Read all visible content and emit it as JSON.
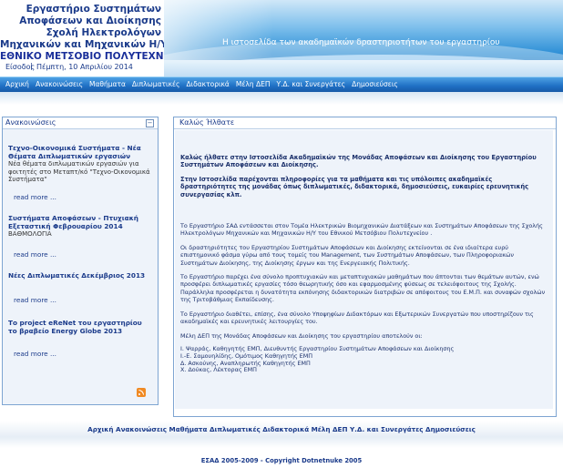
{
  "header": {
    "title_lines": [
      "Εργαστήριο Συστημάτων",
      "Αποφάσεων και Διοίκησης",
      "Σχολή Ηλεκτρολόγων",
      "Μηχανικών και  Μηχανικών Η/Υ",
      "ΕΘΝΙΚΟ ΜΕΤΣΟΒΙΟ ΠΟΛΥΤΕΧΝΕΙΟ"
    ],
    "tagline": "Η ιστοσελίδα των ακαδημαϊκών δραστηριοτήτων του εργαστηρίου",
    "login": "Είσοδος",
    "separator": "|",
    "date": "Πέμπτη, 10 Απριλίου 2014"
  },
  "nav": {
    "items": [
      "Αρχική",
      "Ανακοινώσεις",
      "Μαθήματα",
      "Διπλωματικές",
      "Διδακτορικά",
      "Μέλη ΔΕΠ",
      "Υ.Δ. και Συνεργάτες",
      "Δημοσιεύσεις"
    ]
  },
  "sidebar": {
    "title": "Ανακοινώσεις",
    "minimize": "−",
    "announcements": [
      {
        "title": "Τεχνο-Οικονομικά Συστήματα - Νέα Θέματα Διπλωματικών εργασιών",
        "subtitle": "Νέα θέματα διπλωματικών εργασιών για φοιτητές στο Μεταπτ/κό \"Τεχνο-Οικονομικά Συστήματα\"",
        "more": "read more ..."
      },
      {
        "title": "Συστήματα Αποφάσεων - Πτυχιακή Εξεταστική Φεβρουαρίου 2014",
        "subtitle": "ΒΑΘΜΟΛΟΓΙΑ",
        "more": "read more ..."
      },
      {
        "title": "Νέες Διπλωματικές Δεκέμβριος 2013",
        "subtitle": "",
        "more": "read more ..."
      },
      {
        "title": "Το project eReNet του εργαστηρίου το βραβείο Energy Globe 2013",
        "subtitle": "",
        "more": "read more ..."
      }
    ]
  },
  "main": {
    "title": "Καλώς Ήλθατε",
    "intro1": "Καλώς ήλθατε στην Ιστοσελίδα Ακαδημαϊκών της Μονάδας Αποφάσεων και Διοίκησης του Εργαστηρίου Συστημάτων Αποφάσεων και Διοίκησης.",
    "intro2": "Στην Ιστοσελίδα παρέχονται πληροφορίες για τα μαθήματα και τις υπόλοιπες ακαδημαϊκές δραστηριότητες της μονάδας όπως διπλωματικές, διδακτορικά, δημοσιεύσεις, ευκαιρίες ερευνητικής συνεργασίας κλπ.",
    "para1": "Το Εργαστήριο ΣΑΔ εντάσσεται στον Τομέα Ηλεκτρικών Βιομηχανικών Διατάξεων και Συστημάτων Αποφάσεων της Σχολής Ηλεκτρολόγων Μηχανικών και Μηχανικών Η/Υ του Εθνικού Μετσόβιου Πολυτεχνείου .",
    "para2": "Οι δραστηριότητες του Εργαστηρίου Συστημάτων Αποφάσεων και Διοίκησης εκτείνονται σε ένα ιδιαίτερα ευρύ επιστημονικό φάσμα γύρω από τους τομείς του Management, των Συστημάτων Αποφάσεων, των Πληροφοριακών Συστημάτων Διοίκησης, της Διοίκησης έργων και της Ενεργειακής Πολιτικής.",
    "para3": "Το Εργαστήριο παρέχει ένα σύνολο προπτυχιακών και μεταπτυχιακών μαθημάτων που άπτονται των θεμάτων αυτών, ενώ προσφέρει διπλωματικές εργασίες τόσο θεωρητικής όσο και εφαρμοσμένης φύσεως σε τελειόφοιτους της Σχολής. Παράλληλα προσφέρεται η δυνατότητα εκπόνησης διδακτορικών διατριβών σε απόφοιτους του Ε.Μ.Π. και συναφών σχολών της Τριτοβάθμιας Εκπαίδευσης.",
    "para4": "Το Εργαστήριο διαθέτει, επίσης, ένα σύνολο Υποψηφίων Διδακτόρων και Εξωτερικών Συνεργατών που υποστηρίζουν τις ακαδημαϊκές και ερευνητικές λειτουργίες του.",
    "para5": "Μέλη ΔΕΠ της Μονάδας Αποφάσεων και Διοίκησης του εργαστηρίου αποτελούν οι:",
    "staff": [
      "Ι. Ψαρράς, Καθηγητής ΕΜΠ, Διευθυντής Εργαστηρίου Συστημάτων Αποφάσεων και Διοίκησης",
      "Ι.-Ε. Σαμουηλίδης, Ομότιμος Καθηγητής ΕΜΠ",
      "Δ. Ασκούνης, Αναπληρωτής Καθηγητής ΕΜΠ",
      "Χ. Δούκας, Λέκτορας ΕΜΠ"
    ]
  },
  "footer": {
    "links": "Αρχική Ανακοινώσεις Μαθήματα Διπλωματικές Διδακτορικά Μέλη ΔΕΠ Υ.Δ. και Συνεργάτες Δημοσιεύσεις",
    "copyright": "ΕΣΑΔ 2005-2009 - Copyright Dotnetnuke 2005"
  }
}
